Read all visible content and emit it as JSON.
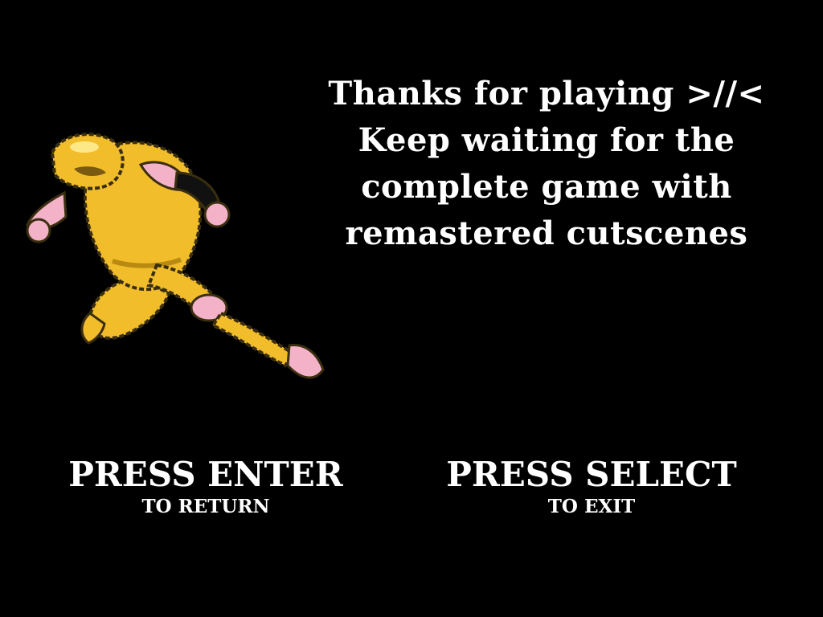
{
  "message": {
    "lines": [
      "Thanks for playing >//<",
      "Keep waiting for the",
      "complete game with",
      "remastered cutscenes"
    ]
  },
  "prompts": {
    "enter": {
      "main": "PRESS ENTER",
      "sub": "TO RETURN"
    },
    "select": {
      "main": "PRESS SELECT",
      "sub": "TO EXIT"
    }
  },
  "character": {
    "icon": "running-hero-sprite"
  },
  "colors": {
    "background": "#000000",
    "text": "#ffffff",
    "suit": "#f2bd2a",
    "skin": "#f4b2c8",
    "outline": "#3a2e10",
    "highlight": "#fff2a0"
  }
}
